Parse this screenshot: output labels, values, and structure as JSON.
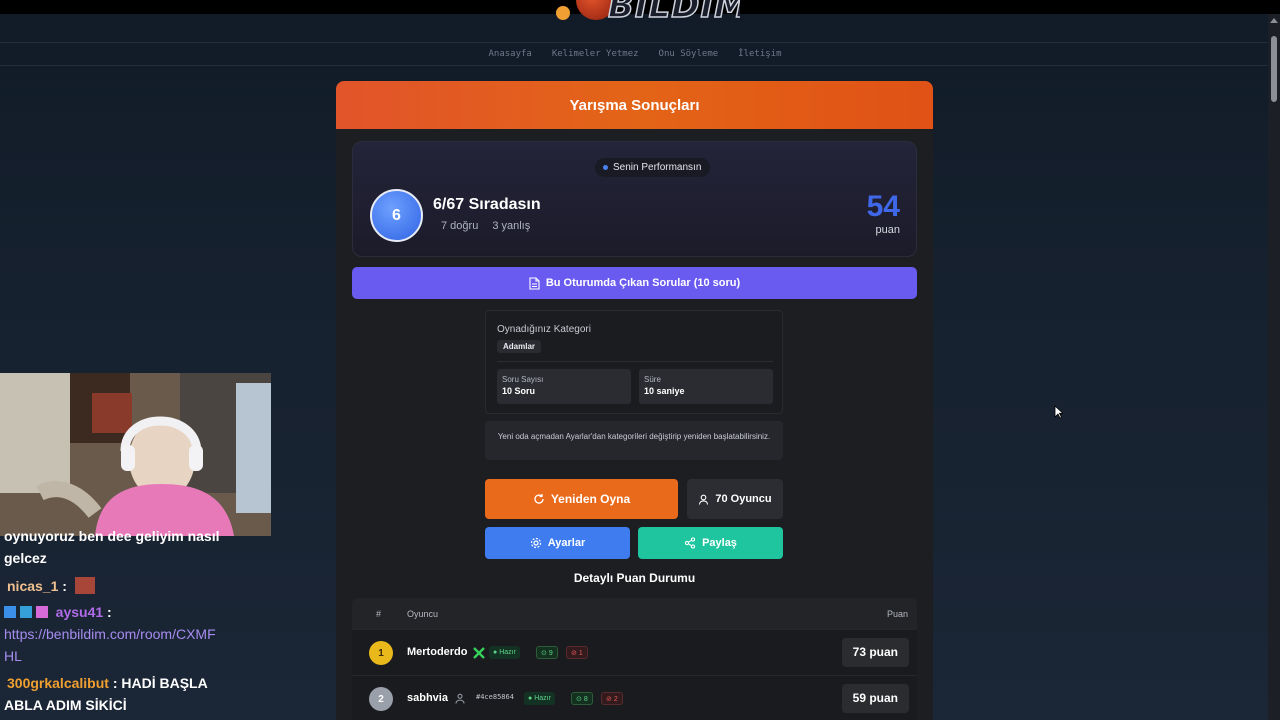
{
  "logo": {
    "text": "BILDIM"
  },
  "nav": [
    "Anasayfa",
    "Kelimeler Yetmez",
    "Onu Söyleme",
    "İletişim"
  ],
  "panel": {
    "title": "Yarışma Sonuçları",
    "performance": {
      "pill": "Senin Performansın",
      "rank": "6",
      "rank_text": "6/67 Sıradasın",
      "correct": "7 doğru",
      "wrong": "3 yanlış",
      "score": "54",
      "score_label": "puan"
    },
    "questions_button": "Bu Oturumda Çıkan Sorular (10 soru)",
    "category": {
      "title": "Oynadığınız Kategori",
      "chip": "Adamlar",
      "stats": [
        {
          "label": "Soru Sayısı",
          "value": "10 Soru"
        },
        {
          "label": "Süre",
          "value": "10 saniye"
        }
      ]
    },
    "note": "Yeni oda açmadan Ayarlar'dan kategorileri değiştirip yeniden başlatabilirsiniz.",
    "buttons": {
      "replay": "Yeniden Oyna",
      "players": "70 Oyuncu",
      "settings": "Ayarlar",
      "share": "Paylaş"
    },
    "detail_title": "Detaylı Puan Durumu",
    "table": {
      "headers": {
        "rank": "#",
        "player": "Oyuncu",
        "score": "Puan"
      },
      "rows": [
        {
          "rank": "1",
          "name": "Mertoderdo",
          "status": "Hazır",
          "correct": "9",
          "wrong": "1",
          "points": "73 puan",
          "uid": ""
        },
        {
          "rank": "2",
          "name": "sabhvia",
          "status": "Hazır",
          "correct": "8",
          "wrong": "2",
          "points": "59 puan",
          "uid": "#4ce85864"
        }
      ]
    }
  },
  "chat": {
    "messages": [
      {
        "user": "",
        "text": "oynuyoruz ben dee geliyim nasıl"
      },
      {
        "user": "",
        "text": "gelcez"
      },
      {
        "user": "nicas_1",
        "text": ""
      },
      {
        "user": "aysu41",
        "text": "https://benbildim.com/room/CXMF"
      },
      {
        "user": "",
        "text": "HL"
      },
      {
        "user": "300grkalcalibut",
        "text": "HADİ BAŞLA"
      },
      {
        "user": "",
        "text": "ABLA ADIM SİKİCİ"
      }
    ]
  },
  "colors": {
    "accent": "#e36417",
    "primary": "#6a5bf0",
    "blue": "#3f7cf0",
    "green": "#1fc59e"
  }
}
